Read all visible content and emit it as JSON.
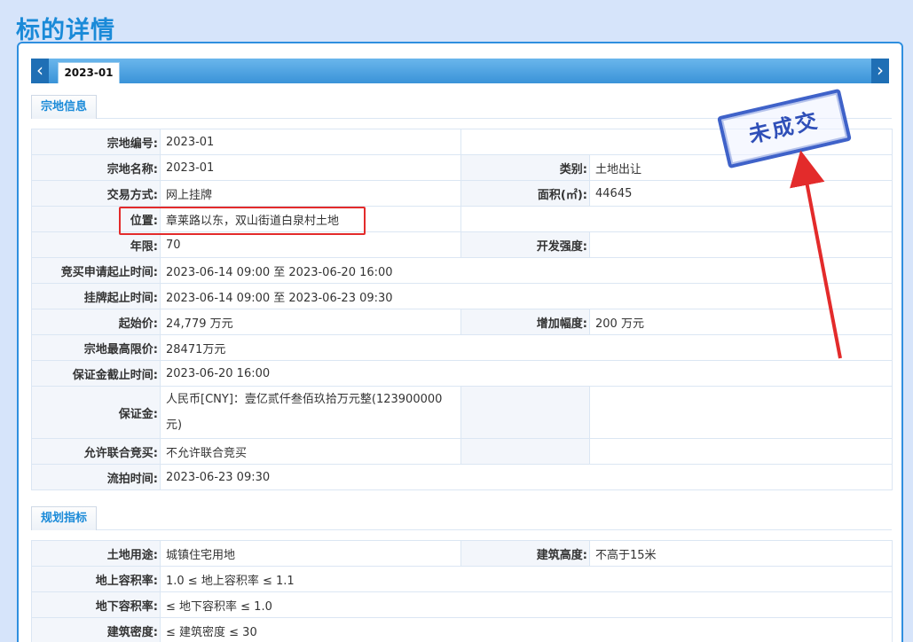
{
  "page_title": "标的详情",
  "tab": {
    "label": "2023-01",
    "prev_icon": "chevron-left-icon",
    "next_icon": "chevron-right-icon",
    "prev_glyph": "‹",
    "next_glyph": "›"
  },
  "stamp_text": "未成交",
  "section1": {
    "title": "宗地信息",
    "rows": {
      "parcel_no": {
        "label": "宗地编号:",
        "value": "2023-01"
      },
      "parcel_name": {
        "label": "宗地名称:",
        "value": "2023-01"
      },
      "category": {
        "label": "类别:",
        "value": "土地出让"
      },
      "trade_method": {
        "label": "交易方式:",
        "value": "网上挂牌"
      },
      "area": {
        "label": "面积(㎡):",
        "value": "44645"
      },
      "location": {
        "label": "位置:",
        "value": "章莱路以东，双山街道白泉村土地"
      },
      "term": {
        "label": "年限:",
        "value": "70"
      },
      "dev_intensity": {
        "label": "开发强度:",
        "value": ""
      },
      "bid_apply_period": {
        "label": "竞买申请起止时间:",
        "value": "2023-06-14 09:00 至 2023-06-20 16:00"
      },
      "listing_period": {
        "label": "挂牌起止时间:",
        "value": "2023-06-14 09:00 至 2023-06-23 09:30"
      },
      "start_price": {
        "label": "起始价:",
        "value": "24,779 万元"
      },
      "increment": {
        "label": "增加幅度:",
        "value": "200 万元"
      },
      "max_price": {
        "label": "宗地最高限价:",
        "value": "28471万元"
      },
      "deposit_deadline": {
        "label": "保证金截止时间:",
        "value": "2023-06-20 16:00"
      },
      "deposit": {
        "label": "保证金:",
        "value": "人民币[CNY]：壹亿贰仟叁佰玖拾万元整(123900000元)"
      },
      "joint_bid": {
        "label": "允许联合竞买:",
        "value": "不允许联合竞买"
      },
      "fail_time": {
        "label": "流拍时间:",
        "value": "2023-06-23 09:30"
      }
    }
  },
  "section2": {
    "title": "规划指标",
    "rows": {
      "land_use": {
        "label": "土地用途:",
        "value": "城镇住宅用地"
      },
      "bldg_height": {
        "label": "建筑高度:",
        "value": "不高于15米"
      },
      "far_above": {
        "label": "地上容积率:",
        "value": "1.0 ≤ 地上容积率 ≤ 1.1"
      },
      "far_below": {
        "label": "地下容积率:",
        "value": "≤ 地下容积率 ≤ 1.0"
      },
      "bldg_density": {
        "label": "建筑密度:",
        "value": "≤ 建筑密度 ≤ 30"
      }
    }
  },
  "colors": {
    "page_bg": "#d6e4fa",
    "accent": "#1a8ad8",
    "stamp": "#3f62c9",
    "annotation": "#e32b2b"
  }
}
